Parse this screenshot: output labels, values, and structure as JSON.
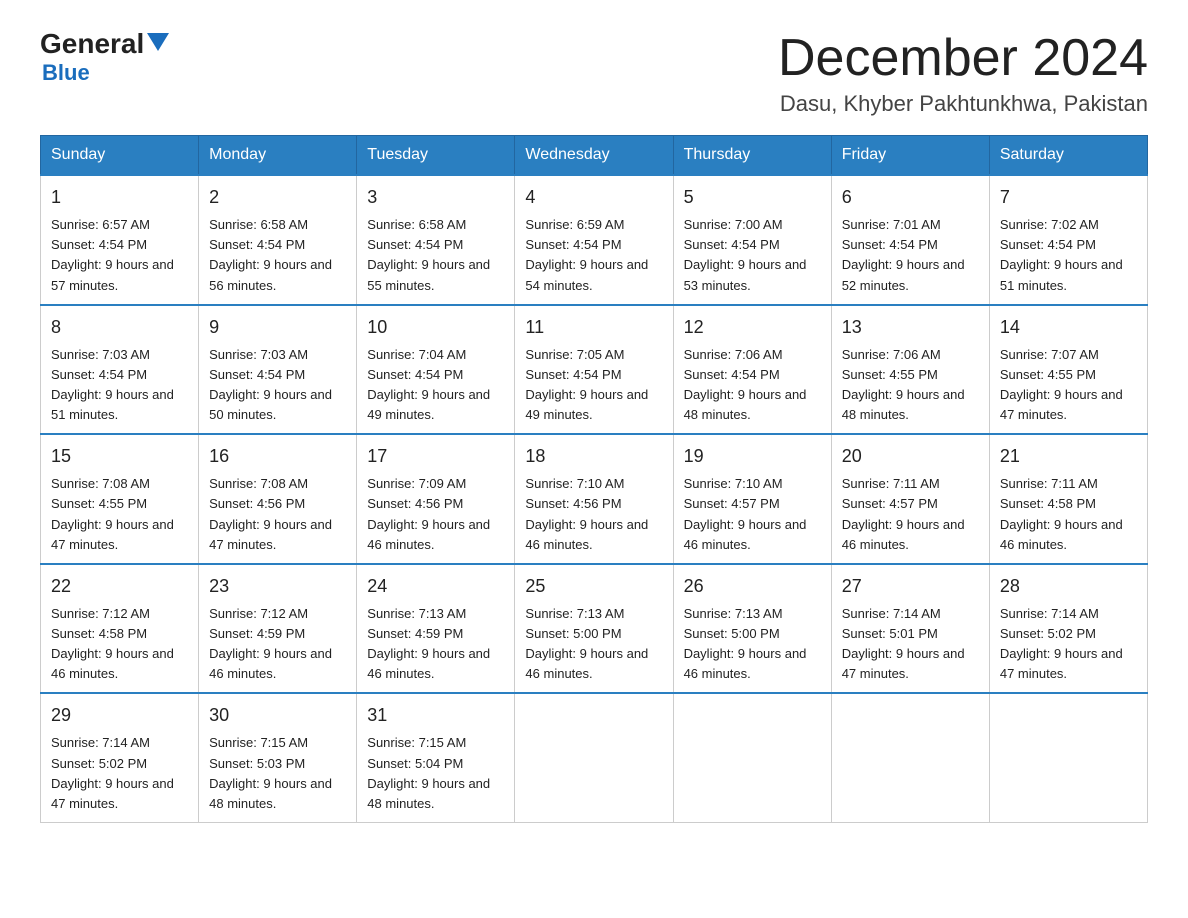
{
  "header": {
    "logo_main": "General",
    "logo_sub": "Blue",
    "month_title": "December 2024",
    "location": "Dasu, Khyber Pakhtunkhwa, Pakistan"
  },
  "days_of_week": [
    "Sunday",
    "Monday",
    "Tuesday",
    "Wednesday",
    "Thursday",
    "Friday",
    "Saturday"
  ],
  "weeks": [
    [
      {
        "day": "1",
        "sunrise": "6:57 AM",
        "sunset": "4:54 PM",
        "daylight": "9 hours and 57 minutes."
      },
      {
        "day": "2",
        "sunrise": "6:58 AM",
        "sunset": "4:54 PM",
        "daylight": "9 hours and 56 minutes."
      },
      {
        "day": "3",
        "sunrise": "6:58 AM",
        "sunset": "4:54 PM",
        "daylight": "9 hours and 55 minutes."
      },
      {
        "day": "4",
        "sunrise": "6:59 AM",
        "sunset": "4:54 PM",
        "daylight": "9 hours and 54 minutes."
      },
      {
        "day": "5",
        "sunrise": "7:00 AM",
        "sunset": "4:54 PM",
        "daylight": "9 hours and 53 minutes."
      },
      {
        "day": "6",
        "sunrise": "7:01 AM",
        "sunset": "4:54 PM",
        "daylight": "9 hours and 52 minutes."
      },
      {
        "day": "7",
        "sunrise": "7:02 AM",
        "sunset": "4:54 PM",
        "daylight": "9 hours and 51 minutes."
      }
    ],
    [
      {
        "day": "8",
        "sunrise": "7:03 AM",
        "sunset": "4:54 PM",
        "daylight": "9 hours and 51 minutes."
      },
      {
        "day": "9",
        "sunrise": "7:03 AM",
        "sunset": "4:54 PM",
        "daylight": "9 hours and 50 minutes."
      },
      {
        "day": "10",
        "sunrise": "7:04 AM",
        "sunset": "4:54 PM",
        "daylight": "9 hours and 49 minutes."
      },
      {
        "day": "11",
        "sunrise": "7:05 AM",
        "sunset": "4:54 PM",
        "daylight": "9 hours and 49 minutes."
      },
      {
        "day": "12",
        "sunrise": "7:06 AM",
        "sunset": "4:54 PM",
        "daylight": "9 hours and 48 minutes."
      },
      {
        "day": "13",
        "sunrise": "7:06 AM",
        "sunset": "4:55 PM",
        "daylight": "9 hours and 48 minutes."
      },
      {
        "day": "14",
        "sunrise": "7:07 AM",
        "sunset": "4:55 PM",
        "daylight": "9 hours and 47 minutes."
      }
    ],
    [
      {
        "day": "15",
        "sunrise": "7:08 AM",
        "sunset": "4:55 PM",
        "daylight": "9 hours and 47 minutes."
      },
      {
        "day": "16",
        "sunrise": "7:08 AM",
        "sunset": "4:56 PM",
        "daylight": "9 hours and 47 minutes."
      },
      {
        "day": "17",
        "sunrise": "7:09 AM",
        "sunset": "4:56 PM",
        "daylight": "9 hours and 46 minutes."
      },
      {
        "day": "18",
        "sunrise": "7:10 AM",
        "sunset": "4:56 PM",
        "daylight": "9 hours and 46 minutes."
      },
      {
        "day": "19",
        "sunrise": "7:10 AM",
        "sunset": "4:57 PM",
        "daylight": "9 hours and 46 minutes."
      },
      {
        "day": "20",
        "sunrise": "7:11 AM",
        "sunset": "4:57 PM",
        "daylight": "9 hours and 46 minutes."
      },
      {
        "day": "21",
        "sunrise": "7:11 AM",
        "sunset": "4:58 PM",
        "daylight": "9 hours and 46 minutes."
      }
    ],
    [
      {
        "day": "22",
        "sunrise": "7:12 AM",
        "sunset": "4:58 PM",
        "daylight": "9 hours and 46 minutes."
      },
      {
        "day": "23",
        "sunrise": "7:12 AM",
        "sunset": "4:59 PM",
        "daylight": "9 hours and 46 minutes."
      },
      {
        "day": "24",
        "sunrise": "7:13 AM",
        "sunset": "4:59 PM",
        "daylight": "9 hours and 46 minutes."
      },
      {
        "day": "25",
        "sunrise": "7:13 AM",
        "sunset": "5:00 PM",
        "daylight": "9 hours and 46 minutes."
      },
      {
        "day": "26",
        "sunrise": "7:13 AM",
        "sunset": "5:00 PM",
        "daylight": "9 hours and 46 minutes."
      },
      {
        "day": "27",
        "sunrise": "7:14 AM",
        "sunset": "5:01 PM",
        "daylight": "9 hours and 47 minutes."
      },
      {
        "day": "28",
        "sunrise": "7:14 AM",
        "sunset": "5:02 PM",
        "daylight": "9 hours and 47 minutes."
      }
    ],
    [
      {
        "day": "29",
        "sunrise": "7:14 AM",
        "sunset": "5:02 PM",
        "daylight": "9 hours and 47 minutes."
      },
      {
        "day": "30",
        "sunrise": "7:15 AM",
        "sunset": "5:03 PM",
        "daylight": "9 hours and 48 minutes."
      },
      {
        "day": "31",
        "sunrise": "7:15 AM",
        "sunset": "5:04 PM",
        "daylight": "9 hours and 48 minutes."
      },
      null,
      null,
      null,
      null
    ]
  ]
}
